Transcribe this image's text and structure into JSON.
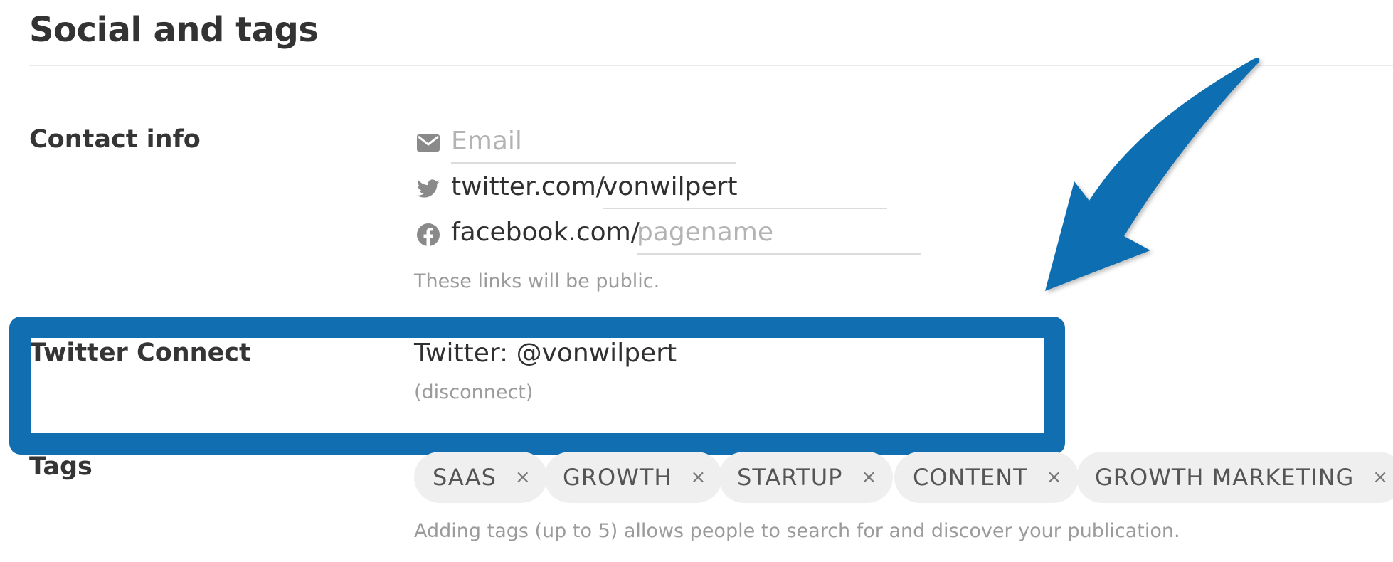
{
  "section": {
    "title": "Social and tags"
  },
  "contact": {
    "label": "Contact info",
    "email": {
      "icon": "envelope-icon",
      "placeholder": "Email",
      "value": ""
    },
    "twitter": {
      "icon": "twitter-bird-icon",
      "prefix": "twitter.com/",
      "value": "vonwilpert"
    },
    "facebook": {
      "icon": "facebook-icon",
      "prefix": "facebook.com/",
      "placeholder": "pagename",
      "value": ""
    },
    "hint": "These links will be public."
  },
  "twitter_connect": {
    "label": "Twitter Connect",
    "status": "Twitter: @vonwilpert",
    "disconnect": "(disconnect)"
  },
  "tags": {
    "label": "Tags",
    "items": [
      "SAAS",
      "GROWTH",
      "STARTUP",
      "CONTENT",
      "GROWTH MARKETING"
    ],
    "remove_glyph": "×",
    "hint": "Adding tags (up to 5) allows people to search for and discover your publication."
  },
  "annotation": {
    "highlight_color": "#106eb1",
    "arrow_color": "#106eb1"
  },
  "colors": {
    "heading": "#333333",
    "placeholder": "#b3b3b3",
    "hint": "#9b9b9b",
    "tag_bg": "#efefef"
  }
}
